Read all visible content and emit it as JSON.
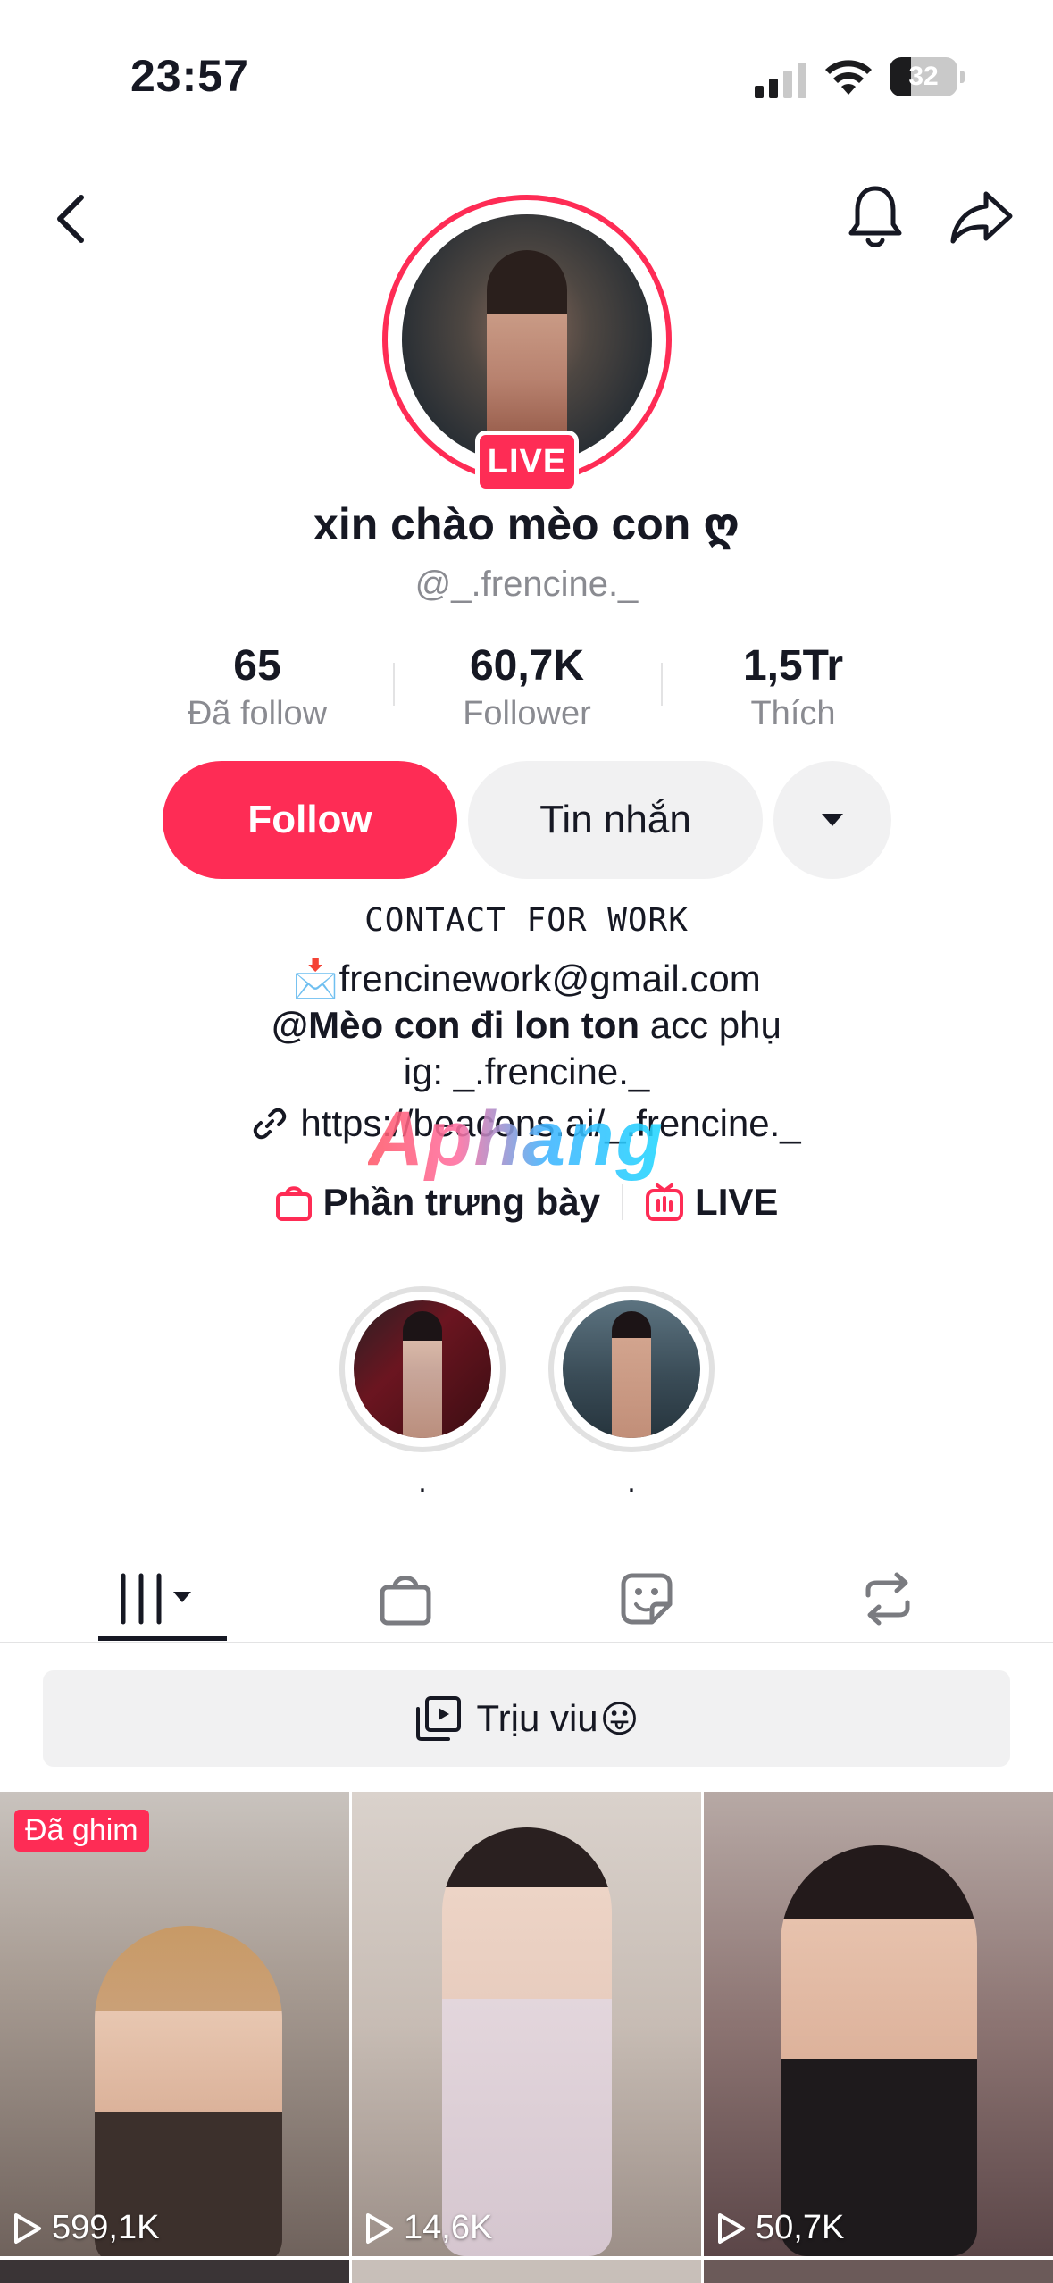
{
  "status_bar": {
    "time": "23:57",
    "battery": "32",
    "battery_percent": 32
  },
  "profile": {
    "display_name": "xin chào mèo con ღ",
    "username": "@_.frencine._",
    "live_badge": "LIVE"
  },
  "stats": [
    {
      "value": "65",
      "label": "Đã follow"
    },
    {
      "value": "60,7K",
      "label": "Follower"
    },
    {
      "value": "1,5Tr",
      "label": "Thích"
    }
  ],
  "actions": {
    "follow": "Follow",
    "message": "Tin nhắn"
  },
  "bio": {
    "contact": "CONTACT FOR WORK",
    "email_emoji": "📩",
    "email": "frencinework@gmail.com",
    "acc_handle": "@Mèo con đi lon ton",
    "acc_suffix": " acc phụ",
    "ig": "ig: _.frencine._",
    "link": "https://beacons.ai/_.frencine._"
  },
  "watermark": "Aphang",
  "shop_row": {
    "showcase": "Phần trưng bày",
    "live": "LIVE"
  },
  "highlights": [
    {
      "label": "."
    },
    {
      "label": "."
    }
  ],
  "playlist": {
    "label": "Trịu viu",
    "emoji": "😛"
  },
  "videos": [
    {
      "pinned": "Đã ghim",
      "views": "599,1K"
    },
    {
      "views": "14,6K"
    },
    {
      "views": "50,7K"
    }
  ],
  "colors": {
    "accent": "#fe2c55",
    "text": "#161823",
    "muted": "#8a8b91",
    "button_bg": "#f1f1f2"
  },
  "icons": {
    "back": "chevron-left-icon",
    "bell": "bell-icon",
    "share": "share-arrow-icon",
    "more": "caret-down-icon",
    "link": "link-icon",
    "shop": "shopping-bag-icon",
    "live": "live-tv-icon",
    "tabs": [
      "videos-grid-icon",
      "shop-bag-icon",
      "sticker-icon",
      "repost-icon"
    ],
    "playlist": "playlist-icon",
    "views": "play-icon"
  }
}
